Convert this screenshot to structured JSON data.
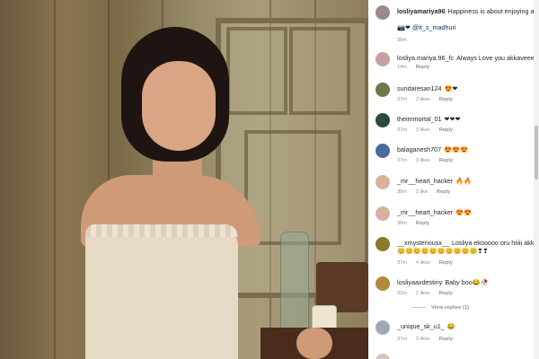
{
  "post": {
    "caption_user": "losliyamariya96",
    "caption_text": "Happiness is about enjoying all y",
    "caption_emojis": "📷❤",
    "caption_mention": "@it_s_madhuri",
    "caption_time": "38m"
  },
  "comments": [
    {
      "user": "losliya.mariya.96_fc",
      "text": "Always Love you akkaveee😍",
      "time": "14m",
      "likes": "",
      "reply": "Reply",
      "bold": false,
      "avatar_color": "#c8a0a0"
    },
    {
      "user": "sundaresan124",
      "text": "😍❤",
      "time": "37m",
      "likes": "3 likes",
      "reply": "Reply",
      "bold": false,
      "avatar_color": "#6a7a4a"
    },
    {
      "user": "theimmortal_01",
      "text": "❤❤❤",
      "time": "37m",
      "likes": "3 likes",
      "reply": "Reply",
      "bold": false,
      "avatar_color": "#2a4a3a"
    },
    {
      "user": "balaganesh707",
      "text": "😍😍😍",
      "time": "37m",
      "likes": "3 likes",
      "reply": "Reply",
      "bold": false,
      "avatar_color": "#4a6a9a"
    },
    {
      "user": "_mr__heart_hacker",
      "text": "🔥🔥",
      "time": "30m",
      "likes": "1 like",
      "reply": "Reply",
      "bold": false,
      "avatar_color": "#d8b0a0"
    },
    {
      "user": "_mr__heart_hacker",
      "text": "😍😍",
      "time": "30m",
      "likes": "",
      "reply": "Reply",
      "bold": false,
      "avatar_color": "#d8b0a0"
    },
    {
      "user": "__xmysteriousx__",
      "text": "Losliya ekooooo oru hiiiii akka",
      "text2": "😊😊😊😊😊😊😊😊😊😊❣❣",
      "time": "37m",
      "likes": "4 likes",
      "reply": "Reply",
      "bold": false,
      "avatar_color": "#8a7a2a"
    },
    {
      "user": "losliyaaxdestiny",
      "text": "Baby boo😂🥀",
      "time": "32m",
      "likes": "2 likes",
      "reply": "Reply",
      "bold": false,
      "avatar_color": "#b08a3a"
    },
    {
      "user": "_unique_sk_u1_",
      "text": "😂",
      "time": "37m",
      "likes": "3 likes",
      "reply": "Reply",
      "bold": false,
      "avatar_color": "#a0a8b8"
    }
  ],
  "view_replies": "View replies (1)"
}
